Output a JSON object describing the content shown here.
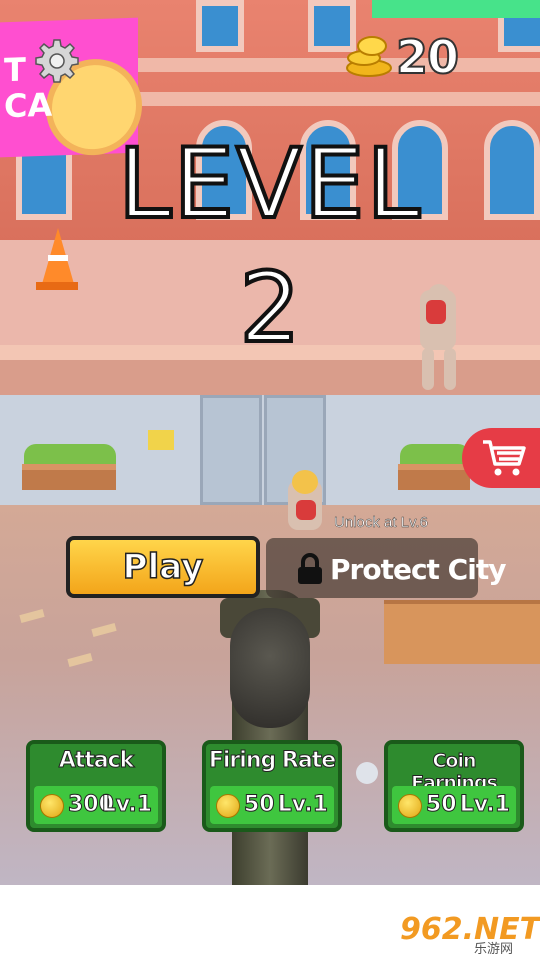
{
  "hud": {
    "coins": "20",
    "level_label": "LEVEL",
    "level_number": "2",
    "settings_icon": "gear-icon",
    "coin_icon": "coin-stack-icon",
    "shop_icon": "cart-icon"
  },
  "sign": {
    "text": "T\nCA"
  },
  "actions": {
    "play_label": "Play",
    "protect_label": "Protect City",
    "protect_unlock_note": "Unlock at Lv.6",
    "lock_icon": "lock-icon"
  },
  "upgrades": [
    {
      "title": "Attack",
      "cost": "300",
      "level": "Lv.1"
    },
    {
      "title": "Firing Rate",
      "cost": "50",
      "level": "Lv.1"
    },
    {
      "title": "Coin Earnings",
      "cost": "50",
      "level": "Lv.1"
    }
  ],
  "watermark": {
    "main": "962.NET",
    "sub": "乐游网"
  },
  "colors": {
    "play": "#f7b82b",
    "upgrade": "#2e8b2e",
    "shop": "#e63c46",
    "health": "#47e38a"
  }
}
